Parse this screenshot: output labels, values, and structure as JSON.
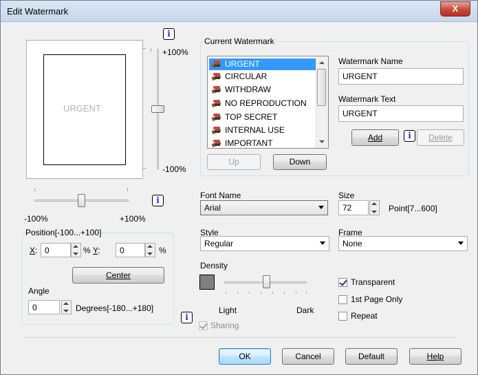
{
  "window": {
    "title": "Edit Watermark",
    "close_label": "X"
  },
  "preview": {
    "watermark_text": "URGENT",
    "vslider_top_label": "+100%",
    "vslider_bottom_label": "-100%",
    "hslider_left_label": "-100%",
    "hslider_right_label": "+100%"
  },
  "position": {
    "group_label": "Position[-100...+100]",
    "x_label": "X",
    "x_value": "0",
    "y_label": "Y",
    "y_value": "0",
    "unit": "%",
    "center_label": "Center"
  },
  "angle": {
    "label": "Angle",
    "value": "0",
    "range_label": "Degrees[-180...+180]"
  },
  "current_watermark": {
    "group_label": "Current Watermark",
    "items": [
      "URGENT",
      "CIRCULAR",
      "WITHDRAW",
      "NO REPRODUCTION",
      "TOP SECRET",
      "INTERNAL USE",
      "IMPORTANT"
    ],
    "selected": "URGENT",
    "up_label": "Up",
    "down_label": "Down"
  },
  "watermark_name": {
    "label": "Watermark Name",
    "value": "URGENT"
  },
  "watermark_text": {
    "label": "Watermark Text",
    "value": "URGENT"
  },
  "buttons": {
    "add": "Add",
    "delete": "Delete",
    "ok": "OK",
    "cancel": "Cancel",
    "default": "Default",
    "help": "Help"
  },
  "font": {
    "label": "Font Name",
    "value": "Arial"
  },
  "size": {
    "label": "Size",
    "value": "72",
    "range": "Point[7...600]"
  },
  "style": {
    "label": "Style",
    "value": "Regular"
  },
  "frame": {
    "label": "Frame",
    "value": "None"
  },
  "density": {
    "label": "Density",
    "light": "Light",
    "dark": "Dark"
  },
  "options": {
    "transparent": {
      "label": "Transparent",
      "checked": true
    },
    "first_page_only": {
      "label": "1st Page Only",
      "checked": false
    },
    "repeat": {
      "label": "Repeat",
      "checked": false
    },
    "sharing": {
      "label": "Sharing",
      "checked": true,
      "disabled": true
    }
  },
  "info_icon_glyph": "i"
}
